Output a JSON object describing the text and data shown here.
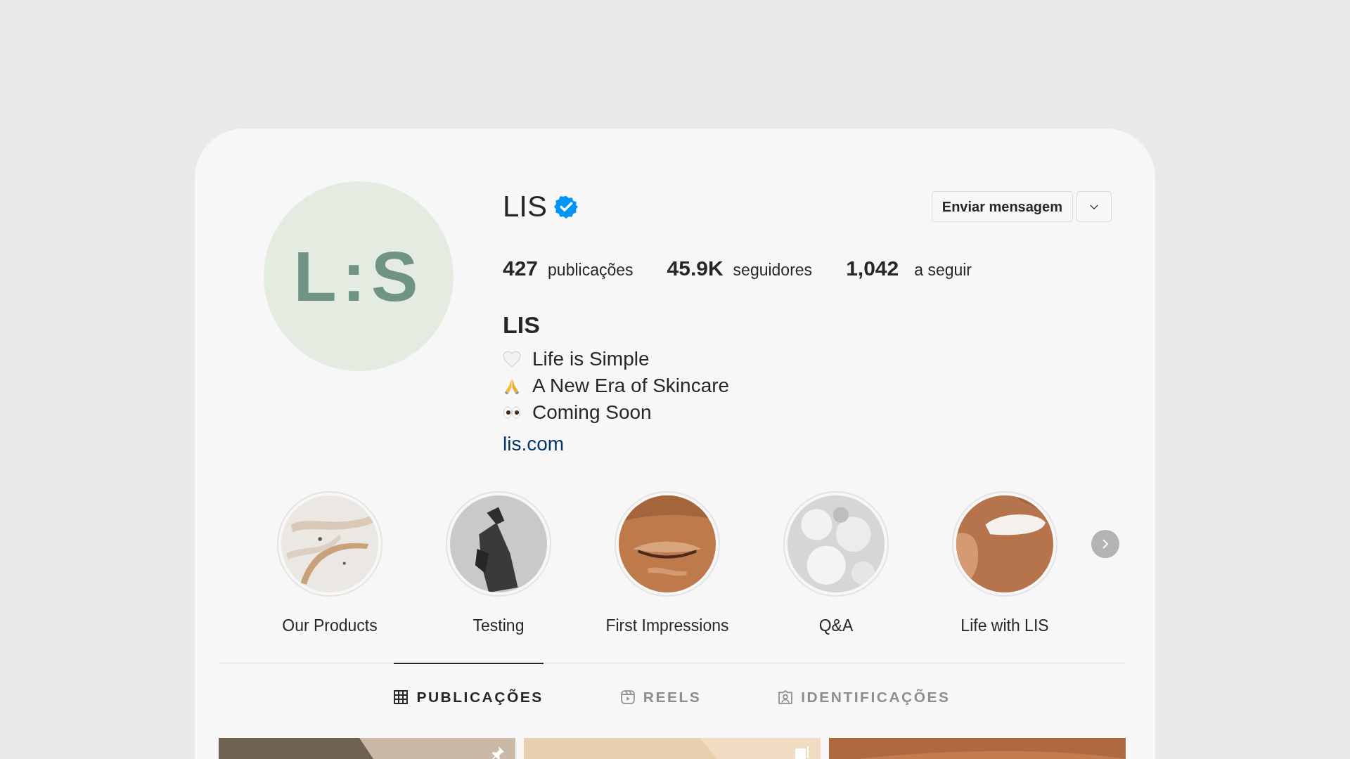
{
  "profile": {
    "avatar_text": "L:S",
    "username": "LIS",
    "verified": true,
    "message_button": "Enviar mensagem",
    "name": "LIS",
    "link": "lis.com"
  },
  "stats": [
    {
      "value": "427",
      "label": "publicações"
    },
    {
      "value": "45.9K",
      "label": "seguidores"
    },
    {
      "value": "1,042",
      "label": "a seguir"
    }
  ],
  "bio": [
    {
      "text": "Life is Simple"
    },
    {
      "text": "A New Era of Skincare"
    },
    {
      "text": "Coming Soon"
    }
  ],
  "highlights": [
    {
      "label": "Our Products",
      "kind": "picture"
    },
    {
      "label": "Testing",
      "kind": "picture"
    },
    {
      "label": "First Impressions",
      "kind": "picture"
    },
    {
      "label": "Q&A",
      "kind": "picture"
    },
    {
      "label": "Life with LIS",
      "kind": "picture"
    }
  ],
  "tabs": [
    {
      "label": "PUBLICAÇÕES",
      "selected": true
    },
    {
      "label": "REELS",
      "selected": false
    },
    {
      "label": "IDENTIFICAÇÕES",
      "selected": false
    }
  ]
}
